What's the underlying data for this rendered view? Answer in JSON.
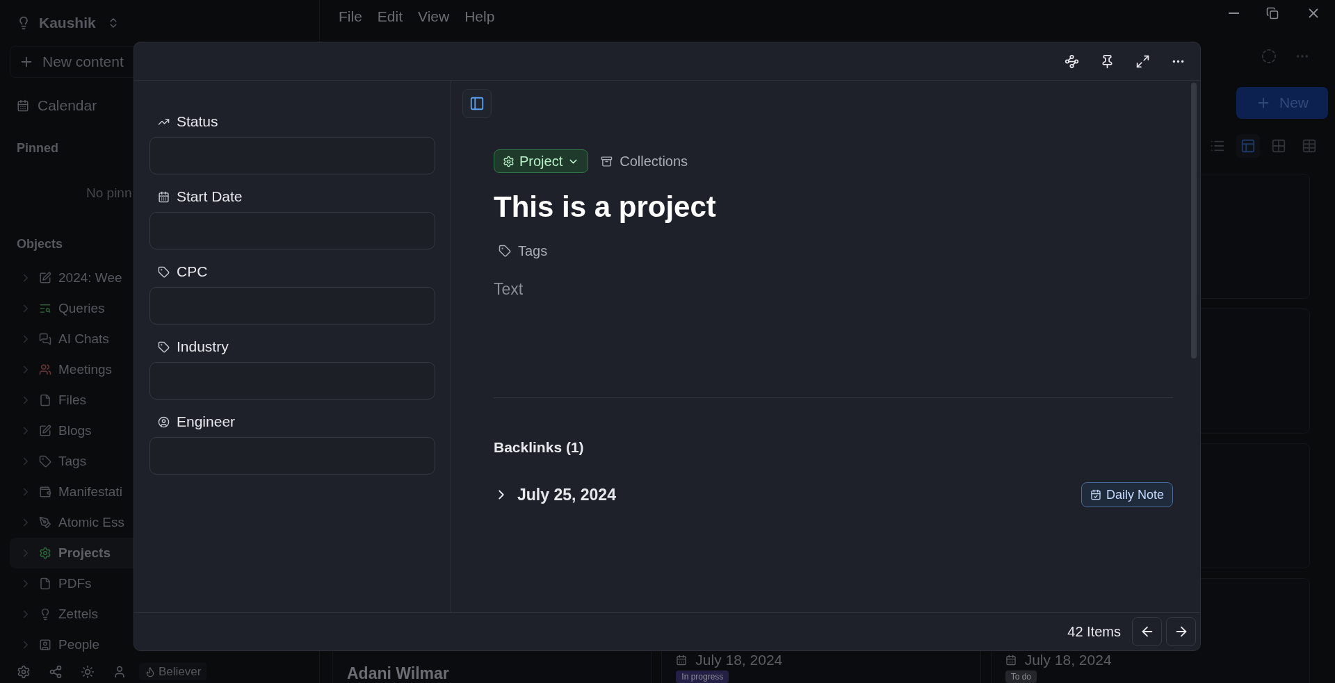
{
  "sidebar": {
    "workspace": "Kaushik",
    "new_content": "New content",
    "calendar": "Calendar",
    "pinned_heading": "Pinned",
    "pinned_empty": "No pinn",
    "objects_heading": "Objects",
    "objects": [
      {
        "label": "2024: Wee",
        "kind": "note",
        "selected": false
      },
      {
        "label": "Queries",
        "kind": "query",
        "selected": false
      },
      {
        "label": "AI Chats",
        "kind": "chat",
        "selected": false
      },
      {
        "label": "Meetings",
        "kind": "people",
        "selected": false
      },
      {
        "label": "Files",
        "kind": "file",
        "selected": false
      },
      {
        "label": "Blogs",
        "kind": "note",
        "selected": false
      },
      {
        "label": "Tags",
        "kind": "tag",
        "selected": false
      },
      {
        "label": "Manifestati",
        "kind": "wallet",
        "selected": false
      },
      {
        "label": "Atomic Ess",
        "kind": "pen",
        "selected": false
      },
      {
        "label": "Projects",
        "kind": "gear",
        "selected": true
      },
      {
        "label": "PDFs",
        "kind": "file",
        "selected": false
      },
      {
        "label": "Zettels",
        "kind": "bulb",
        "selected": false
      },
      {
        "label": "People",
        "kind": "person",
        "selected": false
      }
    ],
    "footer_badge": "Believer"
  },
  "menu": [
    "File",
    "Edit",
    "View",
    "Help"
  ],
  "main": {
    "new_button": "New",
    "view_modes": [
      {
        "kind": "list",
        "selected": false
      },
      {
        "kind": "board",
        "selected": true
      },
      {
        "kind": "grid",
        "selected": false
      },
      {
        "kind": "table",
        "selected": false
      }
    ],
    "cards": [
      {
        "kind": "person",
        "title": "Adani Wilmar"
      },
      {
        "kind": "task",
        "date": "July 18, 2024",
        "status": "In progress",
        "color": "#241f45"
      },
      {
        "kind": "task",
        "date": "July 18, 2024",
        "status": "To do",
        "color": "#24262b"
      }
    ]
  },
  "modal": {
    "properties": [
      {
        "label": "Status",
        "kind": "status"
      },
      {
        "label": "Start Date",
        "kind": "date"
      },
      {
        "label": "CPC",
        "kind": "tag"
      },
      {
        "label": "Industry",
        "kind": "tag"
      },
      {
        "label": "Engineer",
        "kind": "person"
      }
    ],
    "type_chip": "Project",
    "collections": "Collections",
    "title": "This is a project",
    "tags": "Tags",
    "body_placeholder": "Text",
    "backlinks_heading": "Backlinks (1)",
    "backlinks": [
      {
        "title": "July 25, 2024",
        "badge": "Daily Note",
        "expanded": false
      }
    ],
    "item_count": "42 Items"
  }
}
